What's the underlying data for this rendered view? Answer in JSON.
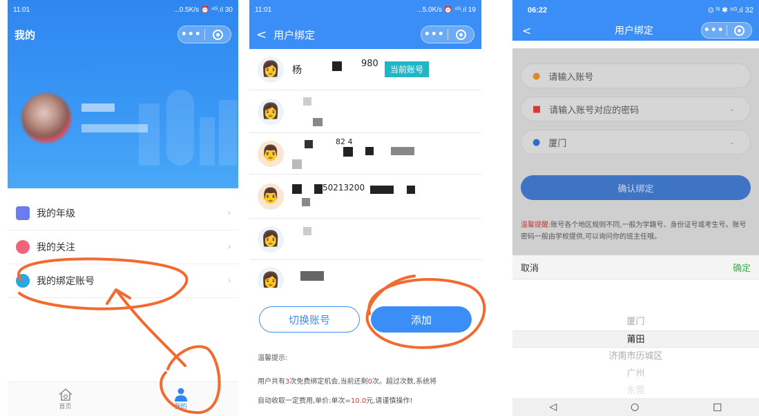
{
  "panel1": {
    "status_time": "11:01",
    "status_right": "...0.5K/s ⏰ ⁴ᴳ.ıl 30",
    "nav_title": "我的",
    "menu": [
      {
        "label": "我的年级"
      },
      {
        "label": "我的关注"
      },
      {
        "label": "我的绑定账号"
      }
    ],
    "tabs": [
      {
        "label": "首页"
      },
      {
        "label": "我的"
      }
    ]
  },
  "panel2": {
    "status_time": "11:01",
    "status_right": "...5.0K/s ⏰ ⁴ᴳ.ıl 19",
    "nav_title": "用户绑定",
    "back_label": "<",
    "accounts": [
      {
        "text_start": "杨",
        "text_end": "980",
        "badge": "当前账号"
      },
      {
        "text_start": "",
        "text_end": "",
        "badge": ""
      },
      {
        "text_start": "",
        "text_end": "82  4",
        "badge": ""
      },
      {
        "text_start": "",
        "text_end": "50213200",
        "badge": ""
      },
      {
        "text_start": "",
        "text_end": "",
        "badge": ""
      },
      {
        "text_start": "",
        "text_end": "",
        "badge": ""
      }
    ],
    "switch_label": "切换账号",
    "add_label": "添加",
    "tip_title": "温馨提示:",
    "tip_line1_a": "用户共有",
    "tip_line1_b": "3",
    "tip_line1_c": "次免费绑定机会,当前还剩",
    "tip_line1_d": "0",
    "tip_line1_e": "次。超过次数,系统将",
    "tip_line2_a": "自动收取一定费用,单价:单次=",
    "tip_line2_b": "10.0",
    "tip_line2_c": "元,请谨慎操作!"
  },
  "panel3": {
    "status_time": "06:22",
    "status_right": "⊙ ᴺ ✱ ⁵ᴳ.ıl 32",
    "nav_title": "用户绑定",
    "back_label": "<",
    "account_placeholder": "请输入账号",
    "password_placeholder": "请输入账号对应的密码",
    "region_value": "厦门",
    "confirm_label": "确认绑定",
    "warn_label": "温馨提醒",
    "warn_text": ":账号各个地区规则不同,一般为学籍号、身份证号或考生号。账号密码一般由学校提供,可以询问你的班主任哦。",
    "cancel_label": "取消",
    "ok_label": "确定",
    "picker": [
      "厦门",
      "莆田",
      "济南市历城区",
      "广州",
      "东莞"
    ],
    "android_nav": [
      "◁",
      "○",
      "□"
    ]
  },
  "colors": {
    "blue": "#3a8ef5",
    "orange": "#f26a2e",
    "green": "#3cae4a",
    "teal_badge": "#20b6c7"
  }
}
